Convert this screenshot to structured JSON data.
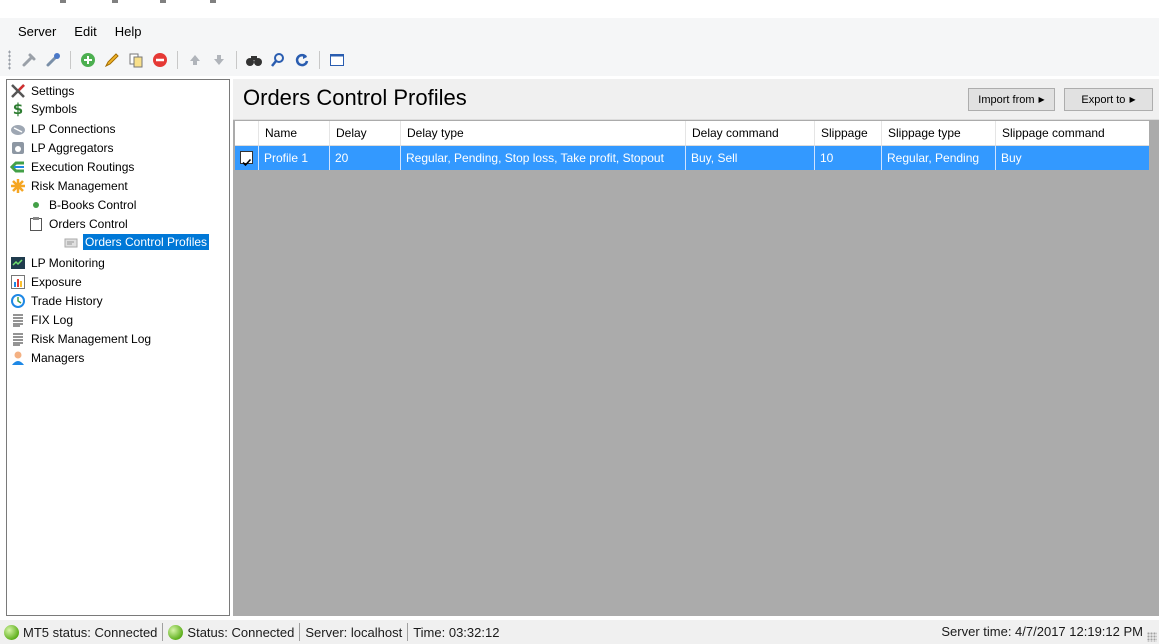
{
  "menu": [
    "Server",
    "Edit",
    "Help"
  ],
  "toolbar": {
    "buttons": [
      "connect-icon",
      "disconnect-icon",
      "add-icon",
      "edit-icon",
      "copy-icon",
      "delete-icon",
      "move-up-icon",
      "move-down-icon",
      "find-icon",
      "search-icon",
      "refresh-icon",
      "window-icon"
    ]
  },
  "sidebar": {
    "items": [
      {
        "label": "Settings",
        "icon": "settings-icon"
      },
      {
        "label": "Symbols",
        "icon": "dollar-icon"
      },
      {
        "label": "LP Connections",
        "icon": "connection-icon"
      },
      {
        "label": "LP Aggregators",
        "icon": "aggregator-icon"
      },
      {
        "label": "Execution Routings",
        "icon": "routing-icon"
      },
      {
        "label": "Risk Management",
        "icon": "risk-icon"
      },
      {
        "label": "B-Books Control",
        "icon": "dot-icon"
      },
      {
        "label": "Orders Control",
        "icon": "clipboard-icon"
      },
      {
        "label": "Orders Control Profiles",
        "icon": "profile-icon"
      },
      {
        "label": "LP Monitoring",
        "icon": "monitor-icon"
      },
      {
        "label": "Exposure",
        "icon": "chart-icon"
      },
      {
        "label": "Trade History",
        "icon": "history-icon"
      },
      {
        "label": "FIX Log",
        "icon": "log-icon"
      },
      {
        "label": "Risk Management Log",
        "icon": "log-icon"
      },
      {
        "label": "Managers",
        "icon": "user-icon"
      }
    ]
  },
  "main": {
    "title": "Orders Control Profiles",
    "import_label": "Import from",
    "export_label": "Export to",
    "columns": [
      "Name",
      "Delay",
      "Delay type",
      "Delay command",
      "Slippage",
      "Slippage type",
      "Slippage command"
    ],
    "rows": [
      {
        "checked": true,
        "name": "Profile 1",
        "delay": "20",
        "delay_type": "Regular, Pending, Stop loss, Take profit, Stopout",
        "delay_command": "Buy, Sell",
        "slippage": "10",
        "slippage_type": "Regular, Pending",
        "slippage_command": "Buy"
      }
    ]
  },
  "status": {
    "mt5": "MT5 status: Connected",
    "status": "Status: Connected",
    "server": "Server: localhost",
    "time": "Time: 03:32:12",
    "server_time": "Server time: 4/7/2017 12:19:12 PM"
  },
  "colors": {
    "selection": "#3399ff",
    "tree_selection": "#0078d7",
    "grid_bg": "#ababab"
  }
}
